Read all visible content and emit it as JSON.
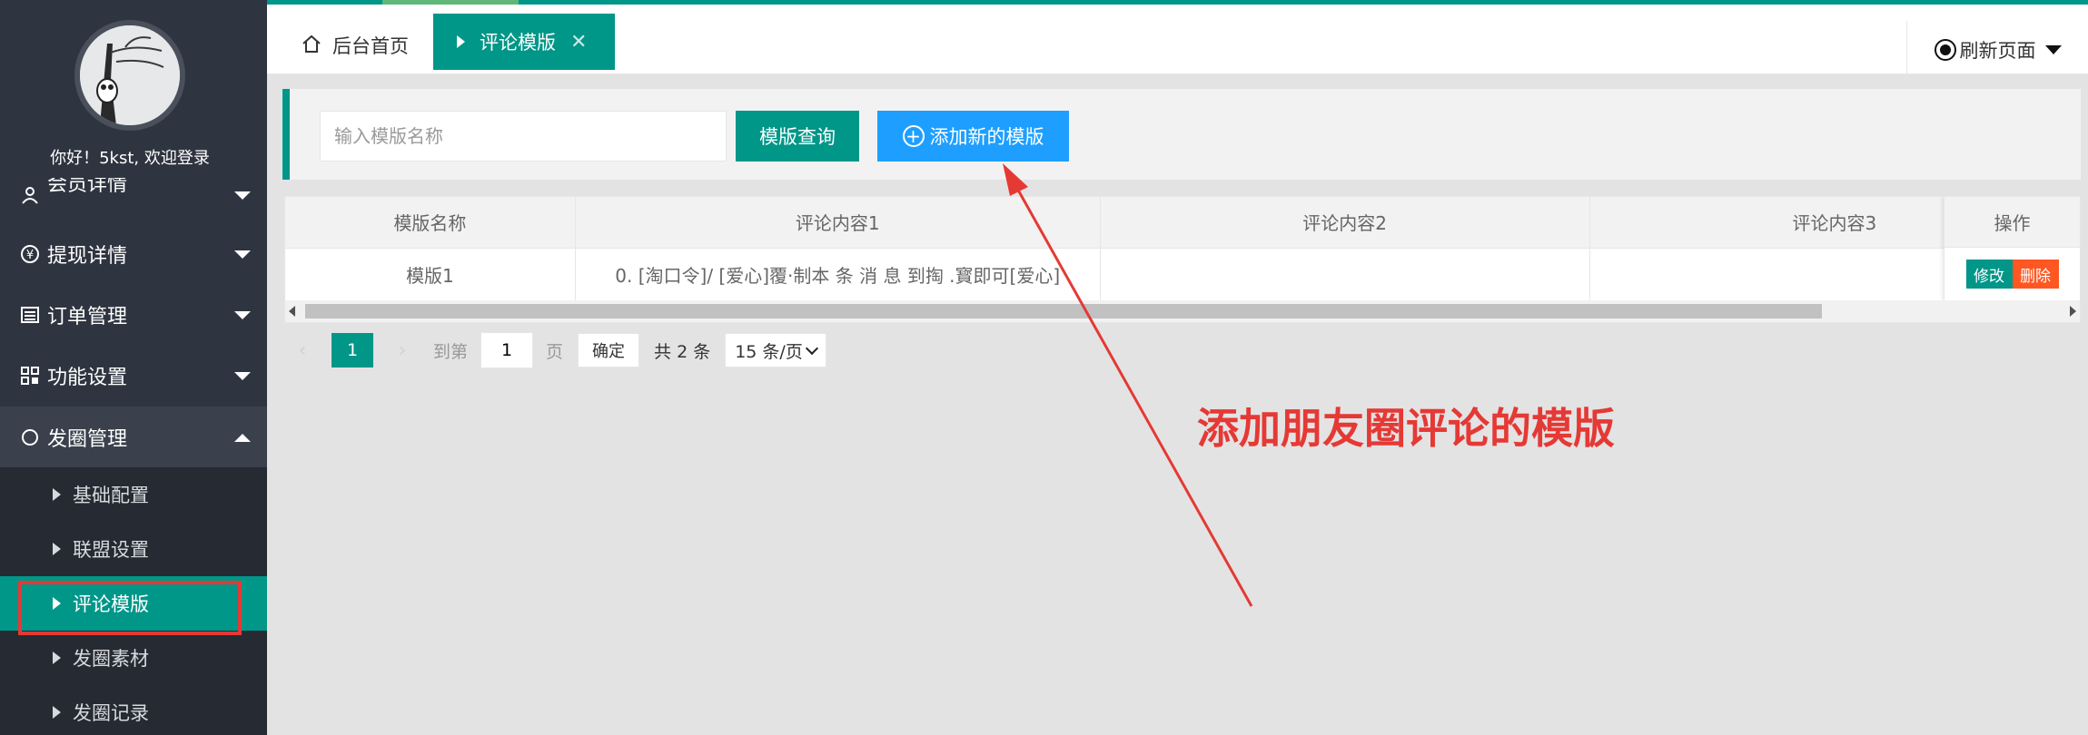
{
  "sidebar": {
    "greeting": "你好！5kst, 欢迎登录",
    "partial_item": {
      "label": "会员详情",
      "icon": "user-icon"
    },
    "items": [
      {
        "label": "提现详情",
        "icon": "yen-icon"
      },
      {
        "label": "订单管理",
        "icon": "list-icon"
      },
      {
        "label": "功能设置",
        "icon": "apps-icon"
      },
      {
        "label": "发圈管理",
        "icon": "circle-icon"
      }
    ],
    "submenu": [
      {
        "label": "基础配置"
      },
      {
        "label": "联盟设置"
      },
      {
        "label": "评论模版",
        "active": true
      },
      {
        "label": "发圈素材"
      },
      {
        "label": "发圈记录"
      }
    ]
  },
  "tabs": {
    "home_label": "后台首页",
    "active_label": "评论模版",
    "close_glyph": "✕",
    "refresh_label": "刷新页面"
  },
  "search": {
    "placeholder": "输入模版名称",
    "query_label": "模版查询",
    "add_label": "添加新的模版",
    "add_icon_glyph": "+"
  },
  "table": {
    "columns": [
      "模版名称",
      "评论内容1",
      "评论内容2",
      "评论内容3"
    ],
    "op_header": "操作",
    "rows": [
      {
        "name": "模版1",
        "content1": "0. [淘口令]/ [爱心]覆·制本 条 消 息 到掏 .寳即可[爱心]",
        "content2": "",
        "content3": ""
      }
    ],
    "edit_label": "修改",
    "delete_label": "删除"
  },
  "pager": {
    "prev_glyph": "‹",
    "next_glyph": "›",
    "current_page": "1",
    "goto_label": "到第",
    "goto_value": "1",
    "page_suffix": "页",
    "confirm_label": "确定",
    "total_label": "共 2 条",
    "page_size": "15 条/页"
  },
  "annotation": {
    "text": "添加朋友圈评论的模版",
    "color": "#e53935"
  },
  "colors": {
    "primary": "#009688",
    "blue": "#1e9fff",
    "danger": "#ff5722",
    "sidebar_bg": "#2f3540"
  }
}
